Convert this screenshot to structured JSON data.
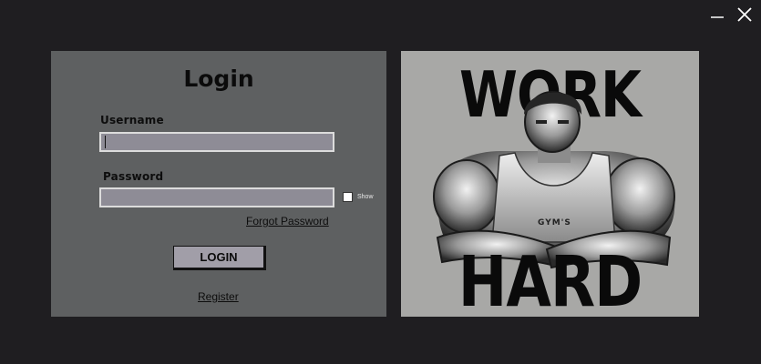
{
  "window": {
    "minimize_icon": "minimize-icon",
    "close_icon": "close-icon"
  },
  "login": {
    "title": "Login",
    "username_label": "Username",
    "username_value": "",
    "password_label": "Password",
    "password_value": "",
    "show_label": "Show",
    "show_checked": false,
    "forgot_password": "Forgot Password",
    "login_button": "LOGIN",
    "register": "Register"
  },
  "poster": {
    "top_text": "WORK",
    "bottom_text": "HARD",
    "shirt_text": "GYM'S"
  },
  "colors": {
    "background": "#1f1e21",
    "panel": "#5e6061",
    "input": "#8e8c96",
    "button": "#a19ea8"
  }
}
